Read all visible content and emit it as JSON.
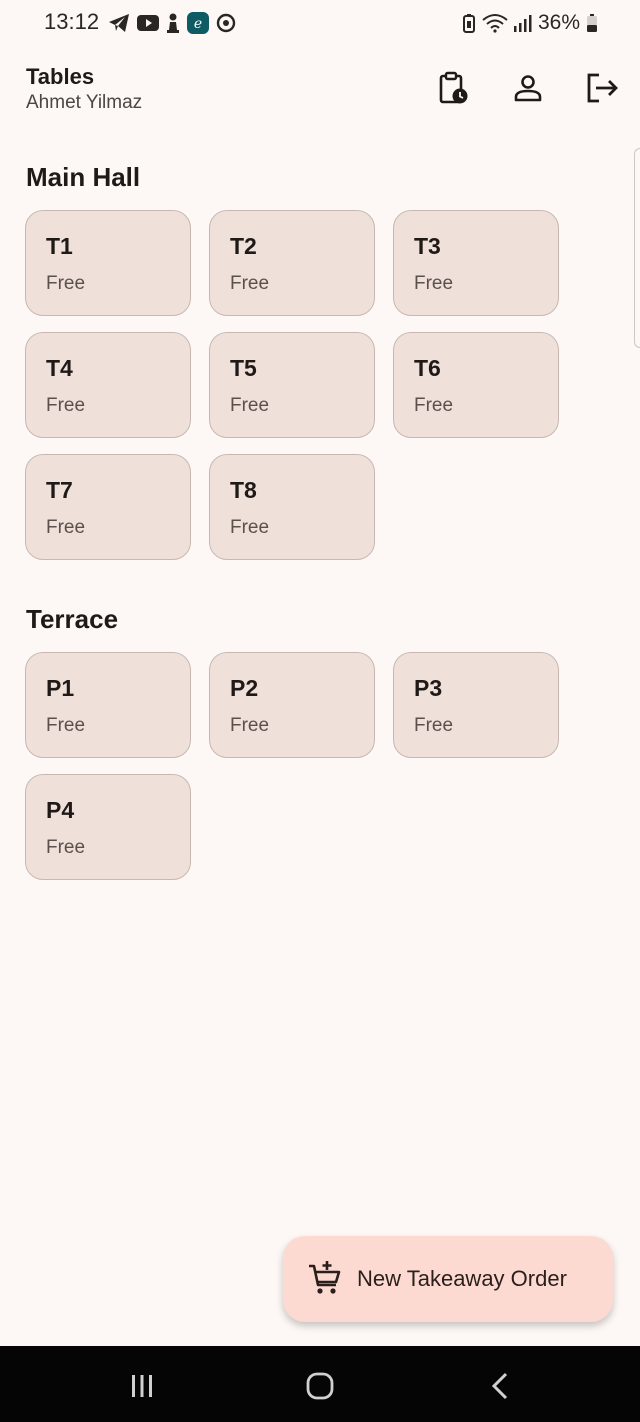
{
  "status_bar": {
    "time": "13:12",
    "left_icons": [
      "telegram-icon",
      "youtube-icon",
      "chess-pawn-icon",
      "app-e-icon",
      "sync-icon"
    ],
    "battery_percent": "36%"
  },
  "header": {
    "title": "Tables",
    "subtitle": "Ahmet Yilmaz",
    "actions": [
      "clipboard-clock-icon",
      "person-icon",
      "logout-icon"
    ]
  },
  "sections": [
    {
      "title": "Main Hall",
      "tables": [
        {
          "name": "T1",
          "status": "Free"
        },
        {
          "name": "T2",
          "status": "Free"
        },
        {
          "name": "T3",
          "status": "Free"
        },
        {
          "name": "T4",
          "status": "Free"
        },
        {
          "name": "T5",
          "status": "Free"
        },
        {
          "name": "T6",
          "status": "Free"
        },
        {
          "name": "T7",
          "status": "Free"
        },
        {
          "name": "T8",
          "status": "Free"
        }
      ]
    },
    {
      "title": "Terrace",
      "tables": [
        {
          "name": "P1",
          "status": "Free"
        },
        {
          "name": "P2",
          "status": "Free"
        },
        {
          "name": "P3",
          "status": "Free"
        },
        {
          "name": "P4",
          "status": "Free"
        }
      ]
    }
  ],
  "fab": {
    "label": "New Takeaway Order",
    "icon": "cart-plus-icon"
  },
  "colors": {
    "background": "#fdf8f5",
    "card": "#f0e0da",
    "card_border": "#c9b8b2",
    "fab": "#fcdad2",
    "navbar": "#050505"
  }
}
